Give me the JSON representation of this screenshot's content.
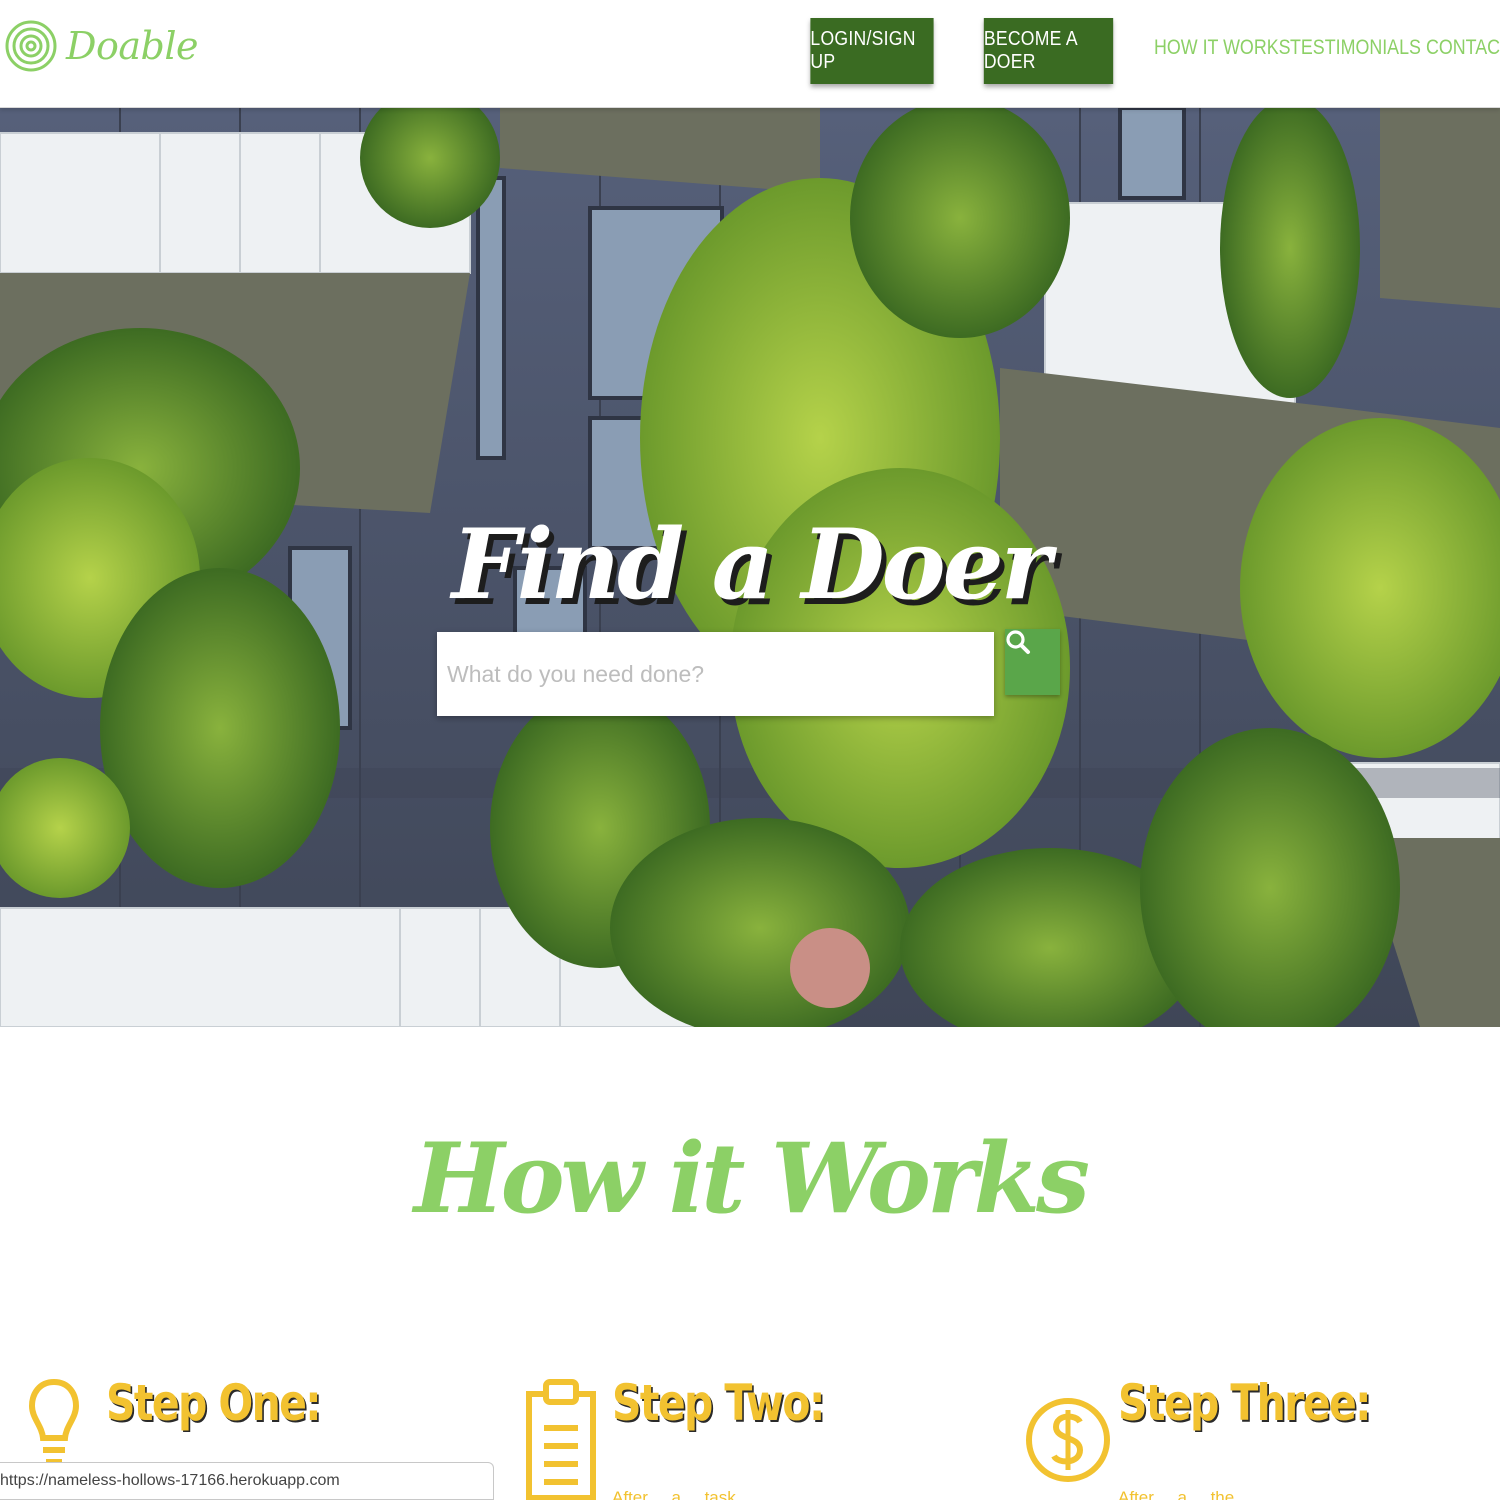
{
  "navbar": {
    "brand": "Doable",
    "login_label": "LOGIN/SIGN UP",
    "become_label": "BECOME A DOER",
    "links": [
      "HOW IT WORKS",
      "TESTIMONIALS",
      "CONTACT"
    ]
  },
  "hero": {
    "title": "Find a Doer",
    "search_placeholder": "What do you need done?"
  },
  "how": {
    "title": "How it Works",
    "steps": [
      {
        "title": "Step One:",
        "icon": "lightbulb-icon",
        "text": ""
      },
      {
        "title": "Step Two:",
        "icon": "clipboard-icon",
        "text": "After ... a ... task ..."
      },
      {
        "title": "Step Three:",
        "icon": "dollar-icon",
        "text": "After ... a ... the"
      }
    ]
  },
  "status_url": "https://nameless-hollows-17166.herokuapp.com",
  "colors": {
    "brand_green": "#8cd066",
    "button_green": "#3a6b22",
    "search_green": "#5aa64a",
    "step_yellow": "#f2c230"
  }
}
